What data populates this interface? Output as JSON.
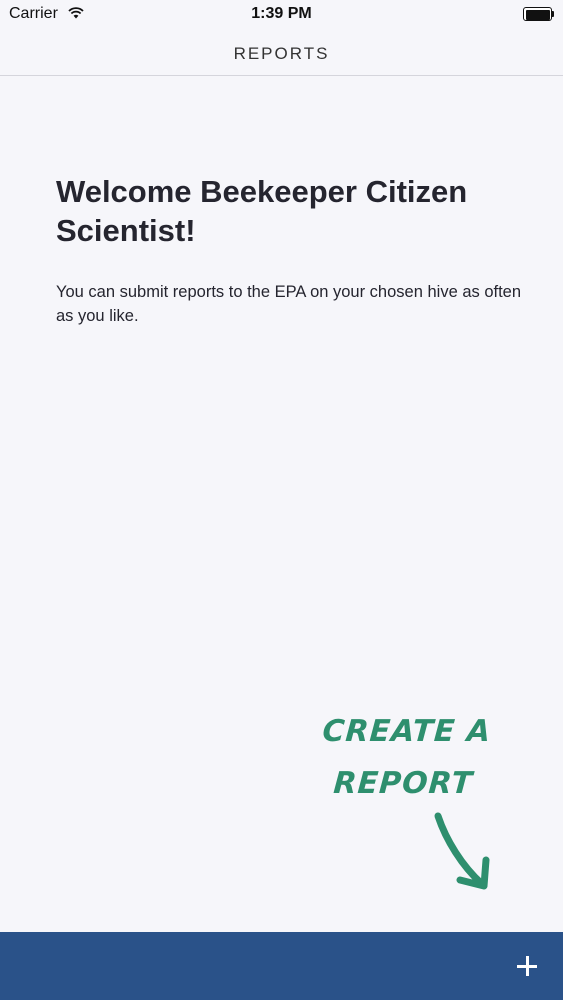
{
  "status_bar": {
    "carrier": "Carrier",
    "time": "1:39 PM",
    "wifi_icon": "wifi-icon",
    "battery_icon": "battery-icon"
  },
  "nav": {
    "title": "REPORTS"
  },
  "content": {
    "heading": "Welcome Beekeeper Citizen Scientist!",
    "body": "You can submit reports to the EPA on your chosen hive as often as you like."
  },
  "hint": {
    "text": "CREATE A REPORT",
    "arrow_icon": "curved-arrow-down-icon"
  },
  "bottom_bar": {
    "add_icon": "plus-icon"
  },
  "colors": {
    "background": "#f6f6fa",
    "accent_green": "#2e8f6e",
    "bottom_bar": "#2a5289"
  }
}
